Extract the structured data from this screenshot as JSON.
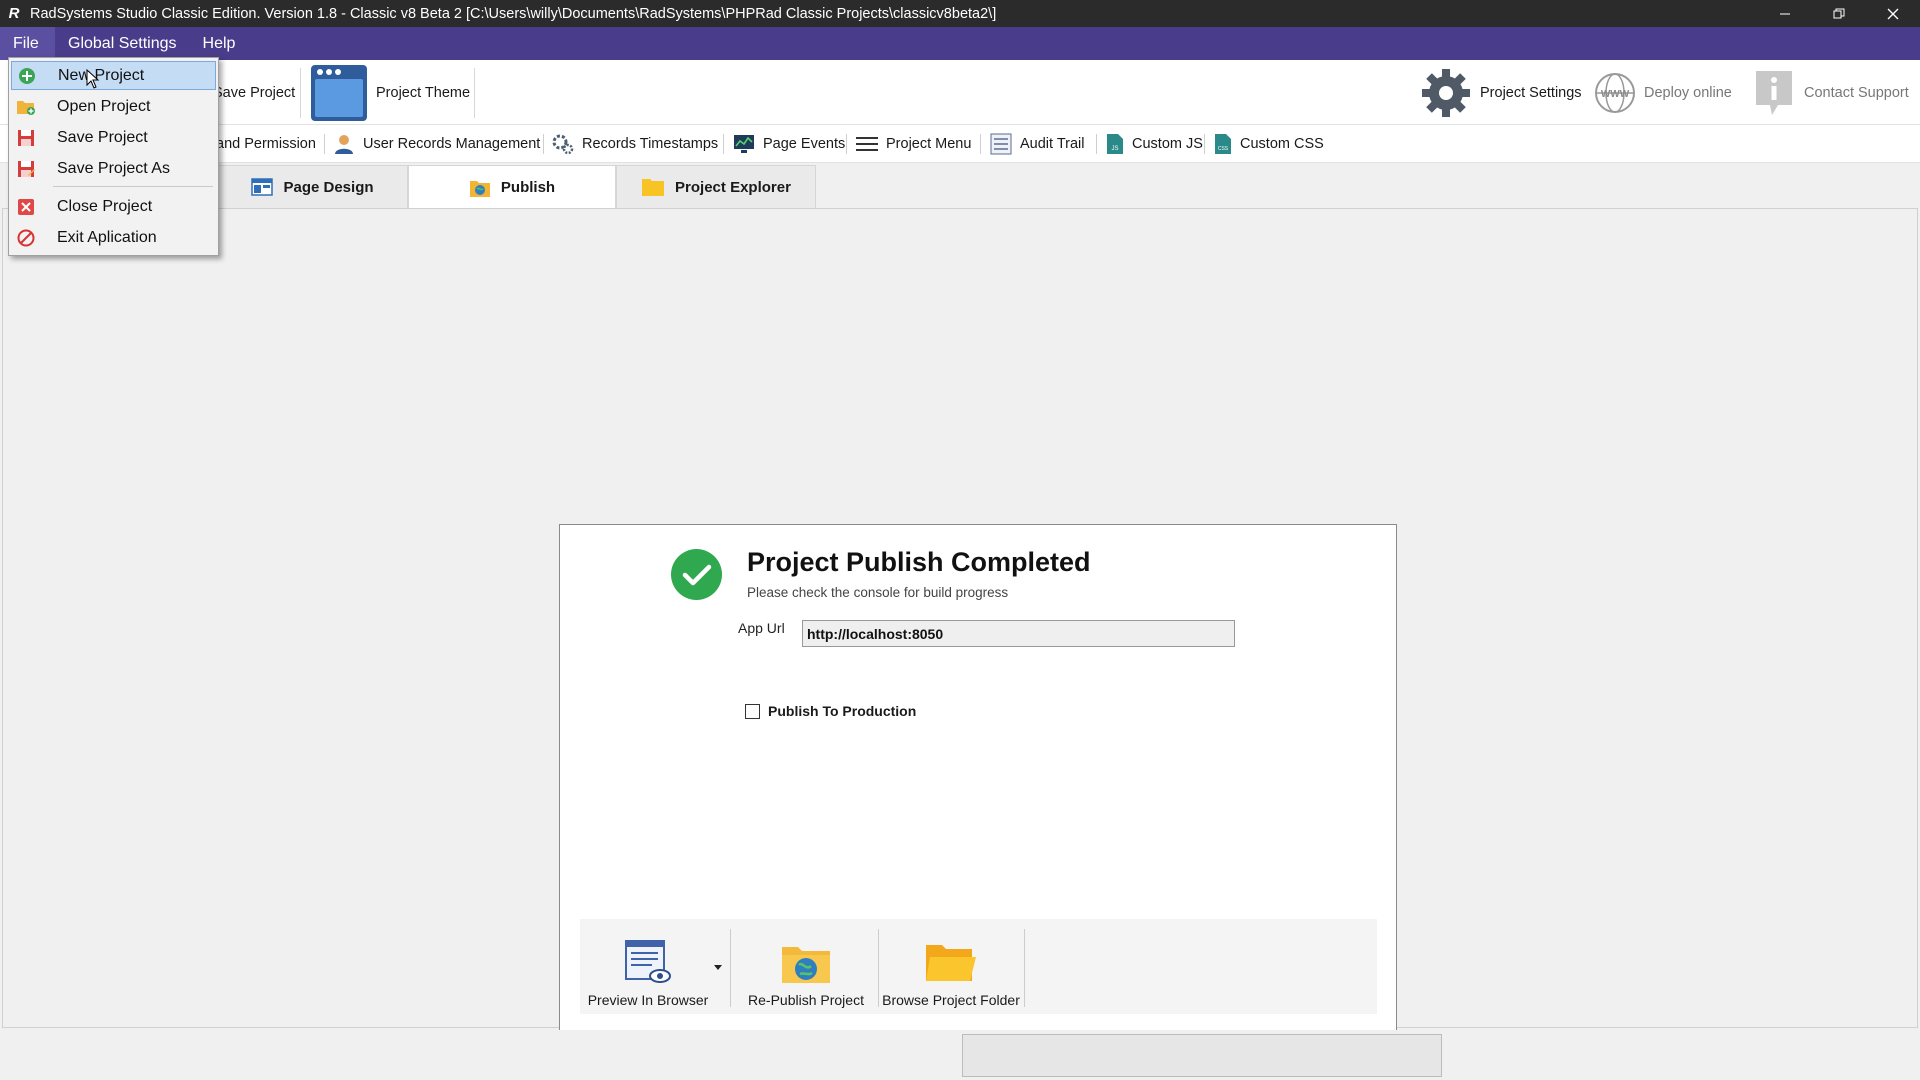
{
  "window": {
    "title": "RadSystems Studio Classic Edition.  Version 1.8 - Classic v8 Beta 2 [C:\\Users\\willy\\Documents\\RadSystems\\PHPRad Classic Projects\\classicv8beta2\\]",
    "app_icon_glyph": "R"
  },
  "menubar": {
    "items": [
      {
        "label": "File"
      },
      {
        "label": "Global Settings"
      },
      {
        "label": "Help"
      }
    ]
  },
  "toolbar": {
    "save_project": "Save Project",
    "project_theme": "Project Theme",
    "project_settings": "Project Settings",
    "deploy_online": "Deploy online",
    "contact_support": "Contact Support"
  },
  "toolbar2": {
    "items": [
      {
        "label": "and Permission"
      },
      {
        "label": "User Records Management"
      },
      {
        "label": "Records Timestamps"
      },
      {
        "label": "Page Events"
      },
      {
        "label": "Project Menu"
      },
      {
        "label": "Audit Trail"
      },
      {
        "label": "Custom JS"
      },
      {
        "label": "Custom CSS"
      }
    ]
  },
  "tabs": [
    {
      "label": "Page Design",
      "active": false
    },
    {
      "label": "Publish",
      "active": true
    },
    {
      "label": "Project Explorer",
      "active": false
    }
  ],
  "publish": {
    "title": "Project Publish Completed",
    "subtitle": "Please check the console for build progress",
    "app_url_label": "App Url",
    "app_url_value": "http://localhost:8050",
    "publish_to_production_label": "Publish To Production",
    "publish_to_production_checked": false,
    "actions": [
      {
        "label": "Preview In Browser"
      },
      {
        "label": "Re-Publish Project"
      },
      {
        "label": "Browse Project Folder"
      }
    ]
  },
  "file_menu": {
    "items": [
      {
        "label": "New Project",
        "icon": "plus-circle-icon",
        "highlighted": true
      },
      {
        "label": "Open Project",
        "icon": "folder-open-icon"
      },
      {
        "label": "Save Project",
        "icon": "floppy-disk-icon"
      },
      {
        "label": "Save Project As",
        "icon": "floppy-disk-as-icon"
      },
      {
        "label": "Close Project",
        "icon": "close-red-icon"
      },
      {
        "label": "Exit Aplication",
        "icon": "no-entry-icon"
      }
    ]
  },
  "statusbar": {
    "progress_fraction": 0
  },
  "colors": {
    "menubar": "#493d8b",
    "titlebar": "#2b2b2b",
    "success_green": "#2fa84f",
    "hover_blue": "#c5dcf5"
  }
}
